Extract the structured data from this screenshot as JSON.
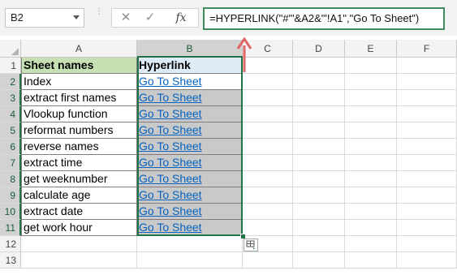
{
  "formula_bar": {
    "name_box": "B2",
    "cancel_symbol": "✕",
    "enter_symbol": "✓",
    "fx_symbol": "fx",
    "formula": "=HYPERLINK(\"#'\"&A2&\"'!A1\",\"Go To Sheet\")"
  },
  "columns": [
    "A",
    "B",
    "C",
    "D",
    "E",
    "F"
  ],
  "rows": [
    "1",
    "2",
    "3",
    "4",
    "5",
    "6",
    "7",
    "8",
    "9",
    "10",
    "11",
    "12",
    "13"
  ],
  "table": {
    "header_a": "Sheet names",
    "header_b": "Hyperlink",
    "sheet_names": [
      "Index",
      "extract  first names",
      "Vlookup function",
      "reformat numbers",
      "reverse names",
      "extract time",
      "get weeknumber",
      "calculate age",
      "extract date",
      "get work hour"
    ],
    "link_text": "Go To Sheet"
  },
  "colors": {
    "header_a_bg": "#c6e0b4",
    "header_b_bg": "#ddebf7",
    "selection": "#217346",
    "link": "#0563c1",
    "arrow": "#e06666"
  },
  "icons": {
    "namebox_dropdown": "chevron-down-icon",
    "formula_bar_grip": "grip-dots-icon",
    "quick_analysis": "quick-analysis-icon",
    "annotation_arrow": "arrow-up-icon"
  }
}
